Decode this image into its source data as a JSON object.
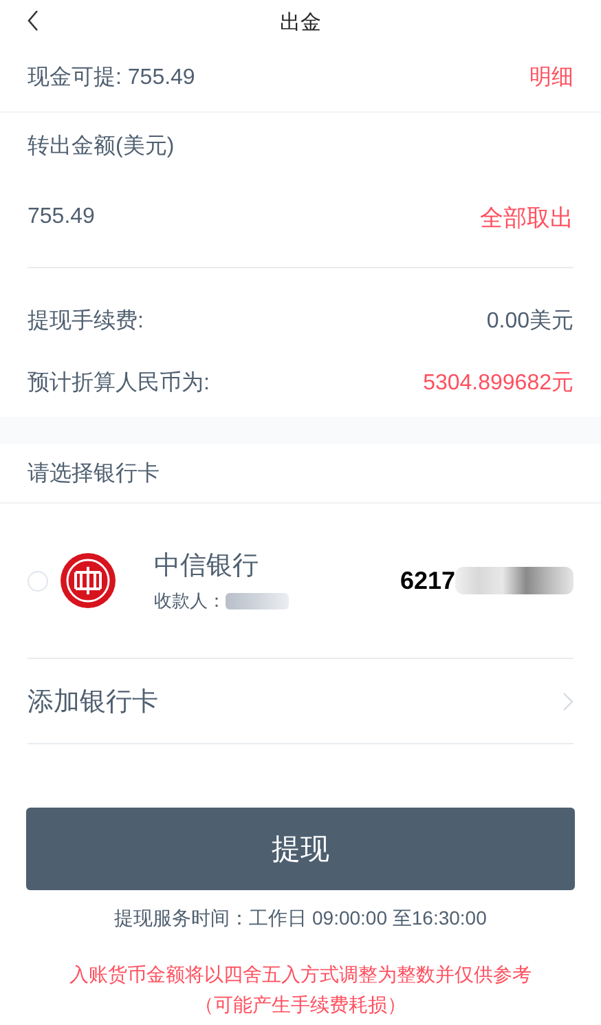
{
  "header": {
    "title": "出金"
  },
  "available": {
    "label": "现金可提: 755.49",
    "link": "明细"
  },
  "amount": {
    "label": "转出金额(美元)",
    "value": "755.49",
    "all_button": "全部取出"
  },
  "fee": {
    "label": "提现手续费:",
    "value": "0.00美元"
  },
  "estimate": {
    "label": "预计折算人民币为:",
    "value": "5304.899682元"
  },
  "bank_section": {
    "title": "请选择银行卡"
  },
  "banks": [
    {
      "name": "中信银行",
      "payee_label": "收款人：",
      "card_prefix": "6217",
      "selected": false
    }
  ],
  "add_card": {
    "label": "添加银行卡"
  },
  "submit": "提现",
  "service_time": "提现服务时间：工作日 09:00:00 至16:30:00",
  "notice": "入账货币金额将以四舍五入方式调整为整数并仅供参考（可能产生手续费耗损）"
}
